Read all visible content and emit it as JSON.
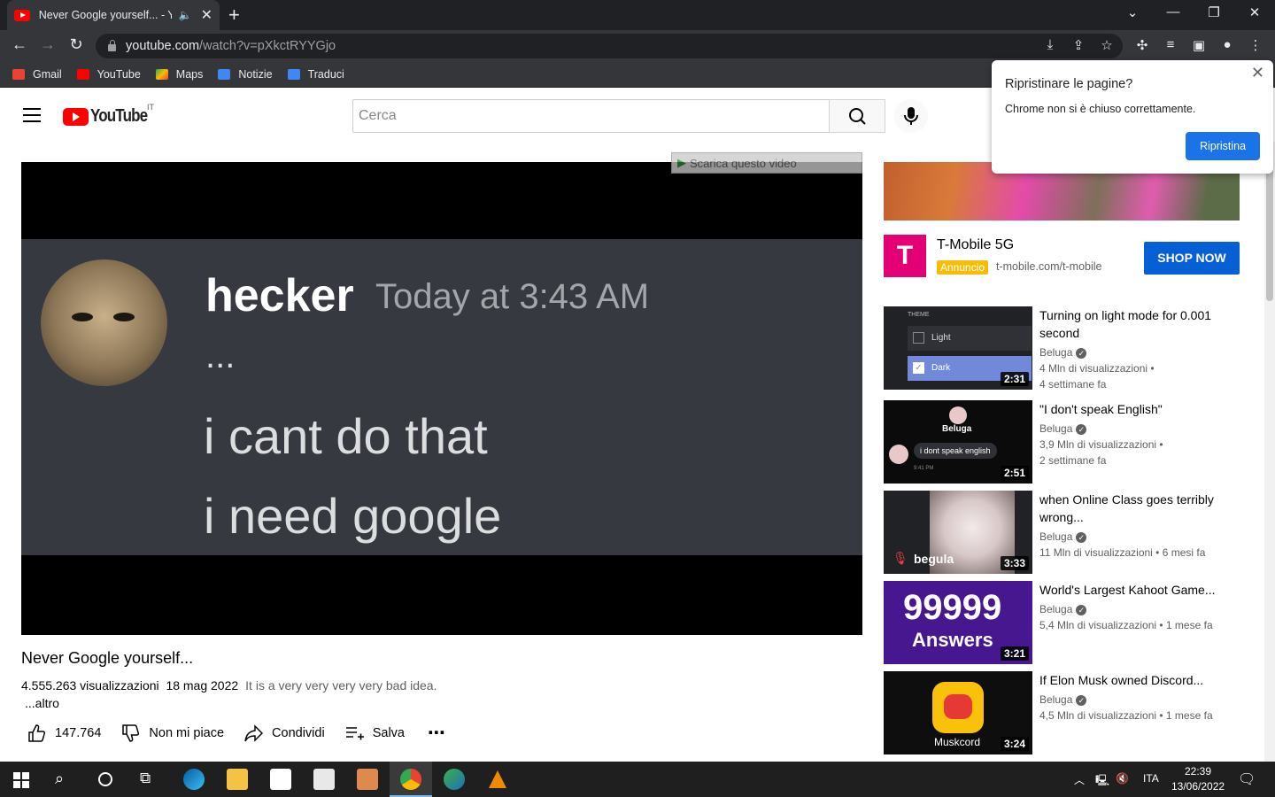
{
  "browser": {
    "tab_title": "Never Google yourself... - Yo",
    "url_host": "youtube.com",
    "url_path": "/watch?v=pXkctRYYGjo",
    "bookmarks": [
      {
        "label": "Gmail",
        "color": "#ea4335"
      },
      {
        "label": "YouTube",
        "color": "#ff0000"
      },
      {
        "label": "Maps",
        "color": "#34a853"
      },
      {
        "label": "Notizie",
        "color": "#4285f4"
      },
      {
        "label": "Traduci",
        "color": "#4285f4"
      }
    ]
  },
  "restore_popup": {
    "title": "Ripristinare le pagine?",
    "message": "Chrome non si è chiuso correttamente.",
    "button": "Ripristina"
  },
  "youtube": {
    "logo_text": "YouTube",
    "country": "IT",
    "search_placeholder": "Cerca"
  },
  "video_frame": {
    "username": "hecker",
    "timestamp": "Today at 3:43 AM",
    "line0": "...",
    "line1": "i cant do that",
    "line2": "i need google",
    "download_bar": "Scarica questo video"
  },
  "video": {
    "title": "Never Google yourself...",
    "views": "4.555.263 visualizzazioni",
    "date": "18 mag 2022",
    "description": "It is a very very very very bad idea.",
    "more": "...altro",
    "likes": "147.764",
    "dislike": "Non mi piace",
    "share": "Condividi",
    "save": "Salva"
  },
  "ad": {
    "title": "T-Mobile 5G",
    "badge": "Annuncio",
    "url": "t-mobile.com/t-mobile",
    "cta": "SHOP NOW"
  },
  "recommendations": [
    {
      "title": "Turning on light mode for 0.001 second",
      "channel": "Beluga",
      "views": "4 Mln di visualizzazioni •",
      "age": "4 settimane fa",
      "duration": "2:31"
    },
    {
      "title": "\"I don't speak English\"",
      "channel": "Beluga",
      "views": "3,9 Mln di visualizzazioni •",
      "age": "2 settimane fa",
      "duration": "2:51"
    },
    {
      "title": "when Online Class goes terribly wrong...",
      "channel": "Beluga",
      "views": "11 Mln di visualizzazioni • 6 mesi fa",
      "age": "",
      "duration": "3:33"
    },
    {
      "title": "World's Largest Kahoot Game...",
      "channel": "Beluga",
      "views": "5,4 Mln di visualizzazioni • 1 mese fa",
      "age": "",
      "duration": "3:21"
    },
    {
      "title": "If Elon Musk owned Discord...",
      "channel": "Beluga",
      "views": "4,5 Mln di visualizzazioni • 1 mese fa",
      "age": "",
      "duration": "3:24"
    }
  ],
  "thumb_text": {
    "theme": "THEME",
    "light": "Light",
    "dark": "Dark",
    "beluga": "Beluga",
    "speech": "i dont speak english",
    "speech_time": "9:41 PM",
    "begula": "begula",
    "kahoot_num": "99999",
    "kahoot_sub": "Answers",
    "muskcord": "Muskcord"
  },
  "taskbar": {
    "lang": "ITA",
    "time": "22:39",
    "date": "13/06/2022"
  }
}
